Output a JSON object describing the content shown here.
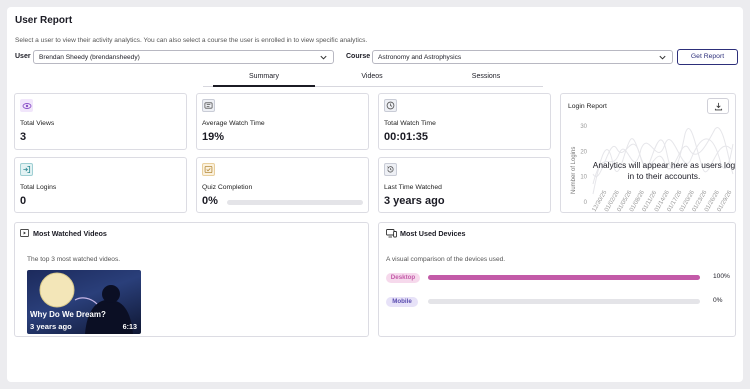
{
  "header": {
    "title": "User Report",
    "subtitle": "Select a user to view their activity analytics. You can also select a course the user is enrolled in to view specific analytics."
  },
  "filters": {
    "user_label": "User",
    "user_value": "Brendan Sheedy (brendansheedy)",
    "course_label": "Course",
    "course_value": "Astronomy and Astrophysics",
    "submit_label": "Get Report"
  },
  "tabs": [
    {
      "label": "Summary",
      "active": true
    },
    {
      "label": "Videos",
      "active": false
    },
    {
      "label": "Sessions",
      "active": false
    }
  ],
  "stats": {
    "total_views": {
      "label": "Total Views",
      "value": "3",
      "icon": "eye-icon"
    },
    "avg_watch": {
      "label": "Average Watch Time",
      "value": "19%",
      "icon": "video-icon"
    },
    "total_watch": {
      "label": "Total Watch Time",
      "value": "00:01:35",
      "icon": "clock-icon"
    },
    "total_logins": {
      "label": "Total Logins",
      "value": "0",
      "icon": "login-icon"
    },
    "quiz": {
      "label": "Quiz Completion",
      "value": "0%",
      "progress": 0,
      "icon": "quiz-icon"
    },
    "last_watched": {
      "label": "Last Time Watched",
      "value": "3 years ago",
      "icon": "history-icon"
    }
  },
  "login_report": {
    "title": "Login Report",
    "download_icon": "download-icon",
    "ylabel": "Number of Logins",
    "yticks": [
      "30",
      "20",
      "10",
      "0"
    ],
    "xticks": [
      "12/30/25",
      "01/02/26",
      "01/05/26",
      "01/08/26",
      "01/11/26",
      "01/14/26",
      "01/17/26",
      "01/20/26",
      "01/23/26",
      "01/26/26",
      "01/29/26"
    ],
    "empty_message": "Analytics will appear here as users log in to their accounts."
  },
  "most_watched": {
    "title": "Most Watched Videos",
    "subtitle": "The top 3 most watched videos.",
    "videos": [
      {
        "title": "Why Do We Dream?",
        "age": "3 years ago",
        "duration": "6:13"
      }
    ]
  },
  "devices": {
    "title": "Most Used Devices",
    "subtitle": "A visual comparison of the devices used.",
    "items": [
      {
        "name": "Desktop",
        "percent": 100,
        "percent_label": "100%",
        "color": "#c35aa8",
        "bg": "#f6d9ec"
      },
      {
        "name": "Mobile",
        "percent": 0,
        "percent_label": "0%",
        "color": "#5b4db0",
        "bg": "#e7e2f8"
      }
    ]
  },
  "colors": {
    "accent": "#2d2f7a",
    "desktop": "#c35aa8"
  }
}
